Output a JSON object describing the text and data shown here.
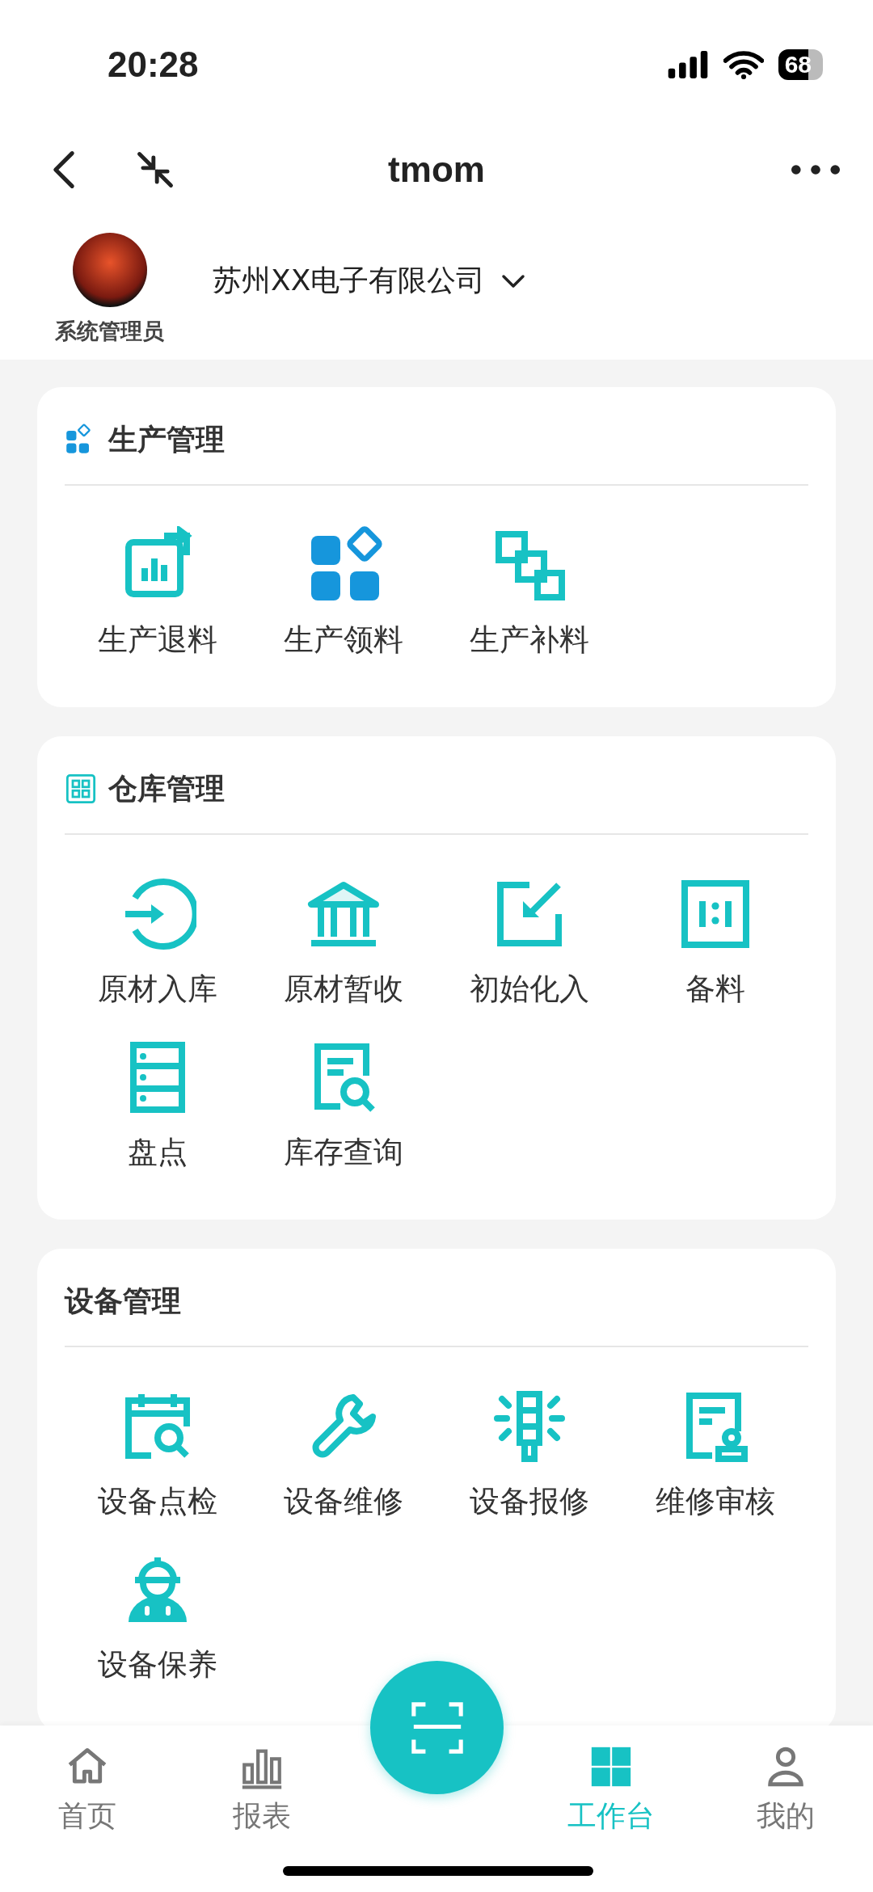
{
  "status_bar": {
    "time": "20:28",
    "battery": "68"
  },
  "nav": {
    "title": "tmom"
  },
  "user": {
    "role": "系统管理员",
    "company": "苏州XX电子有限公司"
  },
  "sections": [
    {
      "title": "生产管理",
      "items": [
        {
          "label": "生产退料"
        },
        {
          "label": "生产领料"
        },
        {
          "label": "生产补料"
        }
      ]
    },
    {
      "title": "仓库管理",
      "items": [
        {
          "label": "原材入库"
        },
        {
          "label": "原材暂收"
        },
        {
          "label": "初始化入"
        },
        {
          "label": "备料"
        },
        {
          "label": "盘点"
        },
        {
          "label": "库存查询"
        }
      ]
    },
    {
      "title": "设备管理",
      "items": [
        {
          "label": "设备点检"
        },
        {
          "label": "设备维修"
        },
        {
          "label": "设备报修"
        },
        {
          "label": "维修审核"
        },
        {
          "label": "设备保养"
        }
      ]
    }
  ],
  "tab_bar": [
    {
      "label": "首页",
      "selected": false
    },
    {
      "label": "报表",
      "selected": false
    },
    {
      "label": "工作台",
      "selected": true
    },
    {
      "label": "我的",
      "selected": false
    }
  ]
}
